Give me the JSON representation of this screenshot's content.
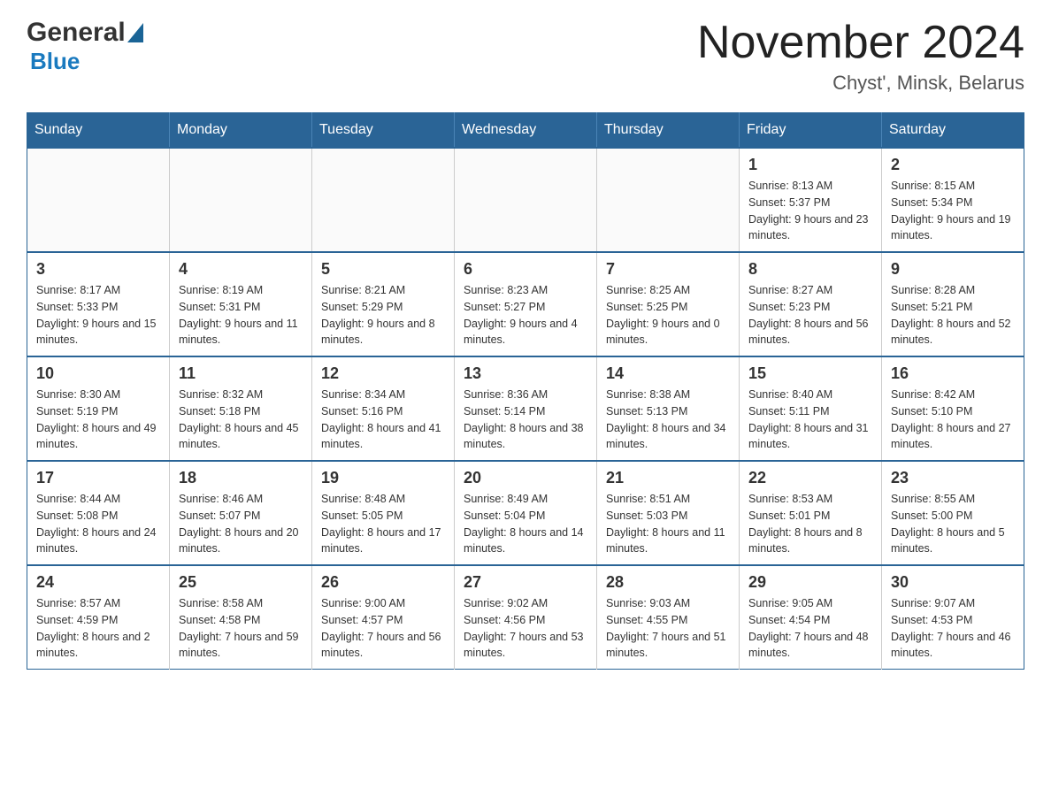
{
  "header": {
    "logo_general": "General",
    "logo_blue": "Blue",
    "title": "November 2024",
    "subtitle": "Chyst', Minsk, Belarus"
  },
  "days_of_week": [
    "Sunday",
    "Monday",
    "Tuesday",
    "Wednesday",
    "Thursday",
    "Friday",
    "Saturday"
  ],
  "weeks": [
    [
      {
        "day": "",
        "info": ""
      },
      {
        "day": "",
        "info": ""
      },
      {
        "day": "",
        "info": ""
      },
      {
        "day": "",
        "info": ""
      },
      {
        "day": "",
        "info": ""
      },
      {
        "day": "1",
        "info": "Sunrise: 8:13 AM\nSunset: 5:37 PM\nDaylight: 9 hours and 23 minutes."
      },
      {
        "day": "2",
        "info": "Sunrise: 8:15 AM\nSunset: 5:34 PM\nDaylight: 9 hours and 19 minutes."
      }
    ],
    [
      {
        "day": "3",
        "info": "Sunrise: 8:17 AM\nSunset: 5:33 PM\nDaylight: 9 hours and 15 minutes."
      },
      {
        "day": "4",
        "info": "Sunrise: 8:19 AM\nSunset: 5:31 PM\nDaylight: 9 hours and 11 minutes."
      },
      {
        "day": "5",
        "info": "Sunrise: 8:21 AM\nSunset: 5:29 PM\nDaylight: 9 hours and 8 minutes."
      },
      {
        "day": "6",
        "info": "Sunrise: 8:23 AM\nSunset: 5:27 PM\nDaylight: 9 hours and 4 minutes."
      },
      {
        "day": "7",
        "info": "Sunrise: 8:25 AM\nSunset: 5:25 PM\nDaylight: 9 hours and 0 minutes."
      },
      {
        "day": "8",
        "info": "Sunrise: 8:27 AM\nSunset: 5:23 PM\nDaylight: 8 hours and 56 minutes."
      },
      {
        "day": "9",
        "info": "Sunrise: 8:28 AM\nSunset: 5:21 PM\nDaylight: 8 hours and 52 minutes."
      }
    ],
    [
      {
        "day": "10",
        "info": "Sunrise: 8:30 AM\nSunset: 5:19 PM\nDaylight: 8 hours and 49 minutes."
      },
      {
        "day": "11",
        "info": "Sunrise: 8:32 AM\nSunset: 5:18 PM\nDaylight: 8 hours and 45 minutes."
      },
      {
        "day": "12",
        "info": "Sunrise: 8:34 AM\nSunset: 5:16 PM\nDaylight: 8 hours and 41 minutes."
      },
      {
        "day": "13",
        "info": "Sunrise: 8:36 AM\nSunset: 5:14 PM\nDaylight: 8 hours and 38 minutes."
      },
      {
        "day": "14",
        "info": "Sunrise: 8:38 AM\nSunset: 5:13 PM\nDaylight: 8 hours and 34 minutes."
      },
      {
        "day": "15",
        "info": "Sunrise: 8:40 AM\nSunset: 5:11 PM\nDaylight: 8 hours and 31 minutes."
      },
      {
        "day": "16",
        "info": "Sunrise: 8:42 AM\nSunset: 5:10 PM\nDaylight: 8 hours and 27 minutes."
      }
    ],
    [
      {
        "day": "17",
        "info": "Sunrise: 8:44 AM\nSunset: 5:08 PM\nDaylight: 8 hours and 24 minutes."
      },
      {
        "day": "18",
        "info": "Sunrise: 8:46 AM\nSunset: 5:07 PM\nDaylight: 8 hours and 20 minutes."
      },
      {
        "day": "19",
        "info": "Sunrise: 8:48 AM\nSunset: 5:05 PM\nDaylight: 8 hours and 17 minutes."
      },
      {
        "day": "20",
        "info": "Sunrise: 8:49 AM\nSunset: 5:04 PM\nDaylight: 8 hours and 14 minutes."
      },
      {
        "day": "21",
        "info": "Sunrise: 8:51 AM\nSunset: 5:03 PM\nDaylight: 8 hours and 11 minutes."
      },
      {
        "day": "22",
        "info": "Sunrise: 8:53 AM\nSunset: 5:01 PM\nDaylight: 8 hours and 8 minutes."
      },
      {
        "day": "23",
        "info": "Sunrise: 8:55 AM\nSunset: 5:00 PM\nDaylight: 8 hours and 5 minutes."
      }
    ],
    [
      {
        "day": "24",
        "info": "Sunrise: 8:57 AM\nSunset: 4:59 PM\nDaylight: 8 hours and 2 minutes."
      },
      {
        "day": "25",
        "info": "Sunrise: 8:58 AM\nSunset: 4:58 PM\nDaylight: 7 hours and 59 minutes."
      },
      {
        "day": "26",
        "info": "Sunrise: 9:00 AM\nSunset: 4:57 PM\nDaylight: 7 hours and 56 minutes."
      },
      {
        "day": "27",
        "info": "Sunrise: 9:02 AM\nSunset: 4:56 PM\nDaylight: 7 hours and 53 minutes."
      },
      {
        "day": "28",
        "info": "Sunrise: 9:03 AM\nSunset: 4:55 PM\nDaylight: 7 hours and 51 minutes."
      },
      {
        "day": "29",
        "info": "Sunrise: 9:05 AM\nSunset: 4:54 PM\nDaylight: 7 hours and 48 minutes."
      },
      {
        "day": "30",
        "info": "Sunrise: 9:07 AM\nSunset: 4:53 PM\nDaylight: 7 hours and 46 minutes."
      }
    ]
  ]
}
